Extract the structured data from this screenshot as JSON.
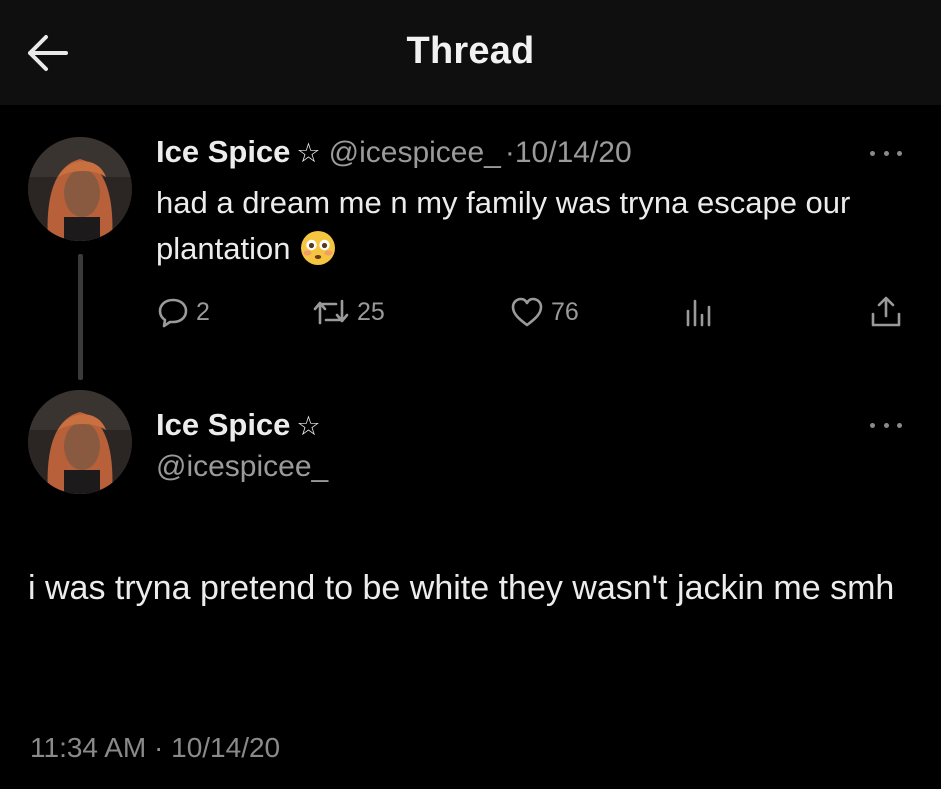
{
  "header": {
    "title": "Thread"
  },
  "tweet1": {
    "name": "Ice Spice",
    "star": "☆",
    "handle": "@icespicee_",
    "separator": "·",
    "date": "10/14/20",
    "text": "had a dream me n my family was tryna escape our plantation",
    "emoji": "flushed-face",
    "actions": {
      "replies": "2",
      "retweets": "25",
      "likes": "76"
    }
  },
  "tweet2": {
    "name": "Ice Spice",
    "star": "☆",
    "handle": "@icespicee_",
    "text": "i was tryna pretend to be white they wasn't jackin me smh",
    "time": "11:34 AM",
    "separator": "·",
    "date": "10/14/20"
  },
  "colors": {
    "background": "#000000",
    "header_bg": "#0f0f0f",
    "text": "#ececec",
    "muted": "#9a9a9a"
  },
  "icons": [
    "back-arrow-icon",
    "more-icon",
    "reply-icon",
    "retweet-icon",
    "like-icon",
    "views-icon",
    "share-icon",
    "star-icon",
    "flushed-face-emoji"
  ]
}
